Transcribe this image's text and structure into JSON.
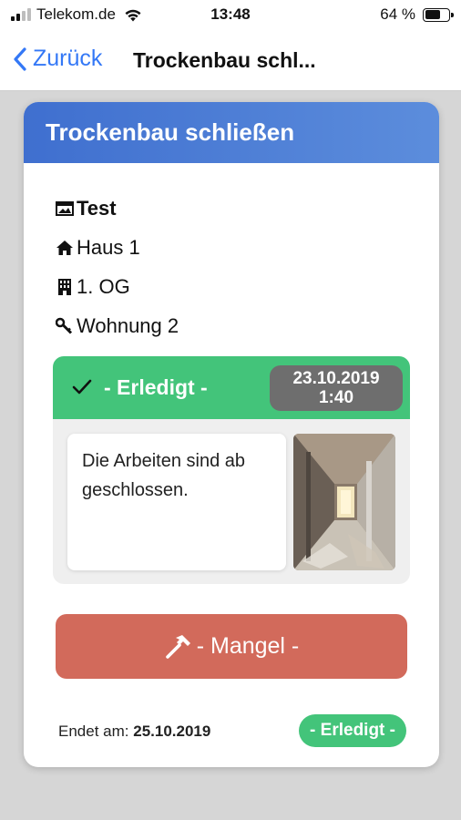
{
  "status_bar": {
    "carrier": "Telekom.de",
    "time": "13:48",
    "battery": "64 %",
    "battery_level": 0.64
  },
  "nav": {
    "back_label": "Zurück",
    "title": "Trockenbau schl..."
  },
  "card": {
    "title": "Trockenbau schließen",
    "info": {
      "project": "Test",
      "building": "Haus 1",
      "floor": "1. OG",
      "unit": "Wohnung 2"
    },
    "status": {
      "label": "- Erledigt -",
      "date": "23.10.2019",
      "time": "1:40",
      "note": "Die Arbeiten sind ab geschlossen.",
      "color": "#43c47a"
    },
    "mangel_button": {
      "label": "- Mangel -",
      "color": "#d26a5b"
    },
    "footer": {
      "ends_label": "Endet am:",
      "ends_date": "25.10.2019",
      "badge": "- Erledigt -"
    }
  },
  "colors": {
    "accent_blue": "#3f6fcf",
    "link_blue": "#3478f6",
    "success": "#43c47a",
    "danger": "#d26a5b"
  }
}
